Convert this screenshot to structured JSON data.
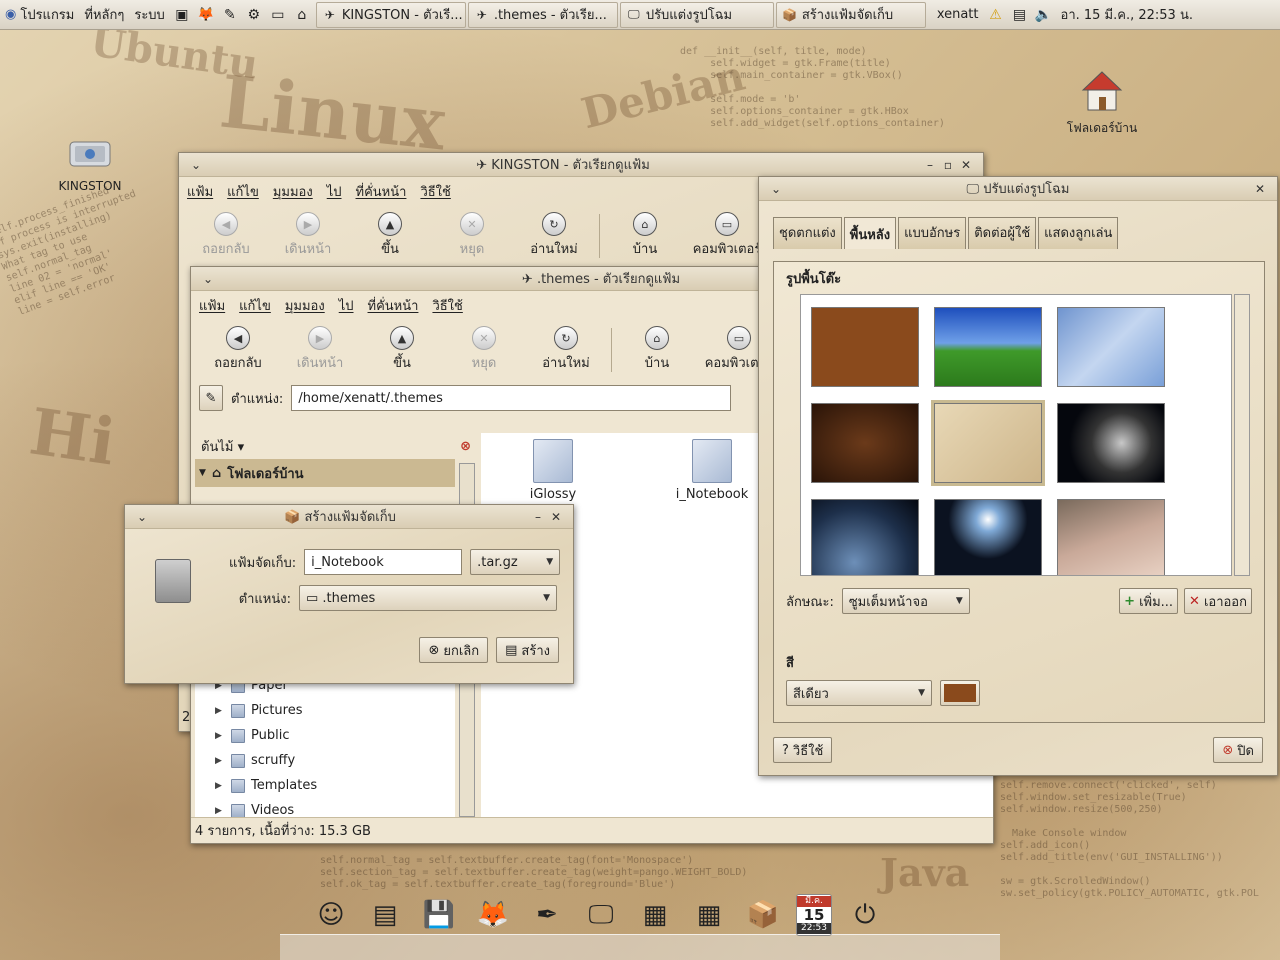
{
  "top_panel": {
    "apps_menu": "โปรแกรม",
    "places_menu": "ที่หลักๆ",
    "system_menu": "ระบบ",
    "tasks": [
      {
        "label": "KINGSTON - ตัวเรี...",
        "icon": "file-manager-icon"
      },
      {
        "label": ".themes - ตัวเรีย...",
        "icon": "file-manager-icon"
      },
      {
        "label": "ปรับแต่งรูปโฉม",
        "icon": "appearance-icon"
      },
      {
        "label": "สร้างแฟ้มจัดเก็บ",
        "icon": "archive-icon"
      }
    ],
    "user": "xenatt",
    "clock": "อา. 15 มี.ค., 22:53 น."
  },
  "desktop": {
    "kingston_label": "KINGSTON",
    "home_label": "โฟลเดอร์บ้าน"
  },
  "win_kingston": {
    "title": "KINGSTON - ตัวเรียกดูแฟ้ม",
    "menu": [
      "แฟ้ม",
      "แก้ไข",
      "มุมมอง",
      "ไป",
      "ที่คั่นหน้า",
      "วิธีใช้"
    ],
    "toolbar": [
      "ถอยกลับ",
      "เดินหน้า",
      "ขึ้น",
      "หยุด",
      "อ่านใหม่",
      "บ้าน",
      "คอมพิวเตอร์"
    ]
  },
  "win_themes": {
    "title": ".themes - ตัวเรียกดูแฟ้ม",
    "menu": [
      "แฟ้ม",
      "แก้ไข",
      "มุมมอง",
      "ไป",
      "ที่คั่นหน้า",
      "วิธีใช้"
    ],
    "toolbar": [
      "ถอยกลับ",
      "เดินหน้า",
      "ขึ้น",
      "หยุด",
      "อ่านใหม่",
      "บ้าน",
      "คอมพิวเตอร์"
    ],
    "location_label": "ตำแหน่ง:",
    "location_value": "/home/xenatt/.themes",
    "sidebar_mode": "ต้นไม้",
    "tree_root": "โฟลเดอร์บ้าน",
    "tree_items": [
      "Paper",
      "Pictures",
      "Public",
      "scruffy",
      "Templates",
      "Videos"
    ],
    "files": [
      "iGlossy",
      "i_Notebook"
    ],
    "status": "4 รายการ, เนื้อที่ว่าง: 15.3 GB",
    "left_digit": "2"
  },
  "dlg_archive": {
    "title": "สร้างแฟ้มจัดเก็บ",
    "archive_label": "แฟ้มจัดเก็บ:",
    "archive_name": "i_Notebook",
    "extension": ".tar.gz",
    "location_label": "ตำแหน่ง:",
    "location_value": ".themes",
    "cancel": "ยกเลิก",
    "create": "สร้าง"
  },
  "win_appearance": {
    "title": "ปรับแต่งรูปโฉม",
    "tabs": [
      "ชุดตกแต่ง",
      "พื้นหลัง",
      "แบบอักษร",
      "ติดต่อผู้ใช้",
      "แสดงลูกเล่น"
    ],
    "active_tab": 1,
    "wallpaper_heading": "รูปพื้นโต๊ะ",
    "style_label": "ลักษณะ:",
    "style_value": "ซูมเต็มหน้าจอ",
    "add": "เพิ่ม...",
    "remove": "เอาออก",
    "color_heading": "สี",
    "color_mode": "สีเดียว",
    "color_swatch": "#8a4a1c",
    "help": "วิธีใช้",
    "close": "ปิด"
  },
  "dock": {
    "calendar_month": "มี.ค.",
    "calendar_day": "15",
    "calendar_time": "22:53"
  }
}
